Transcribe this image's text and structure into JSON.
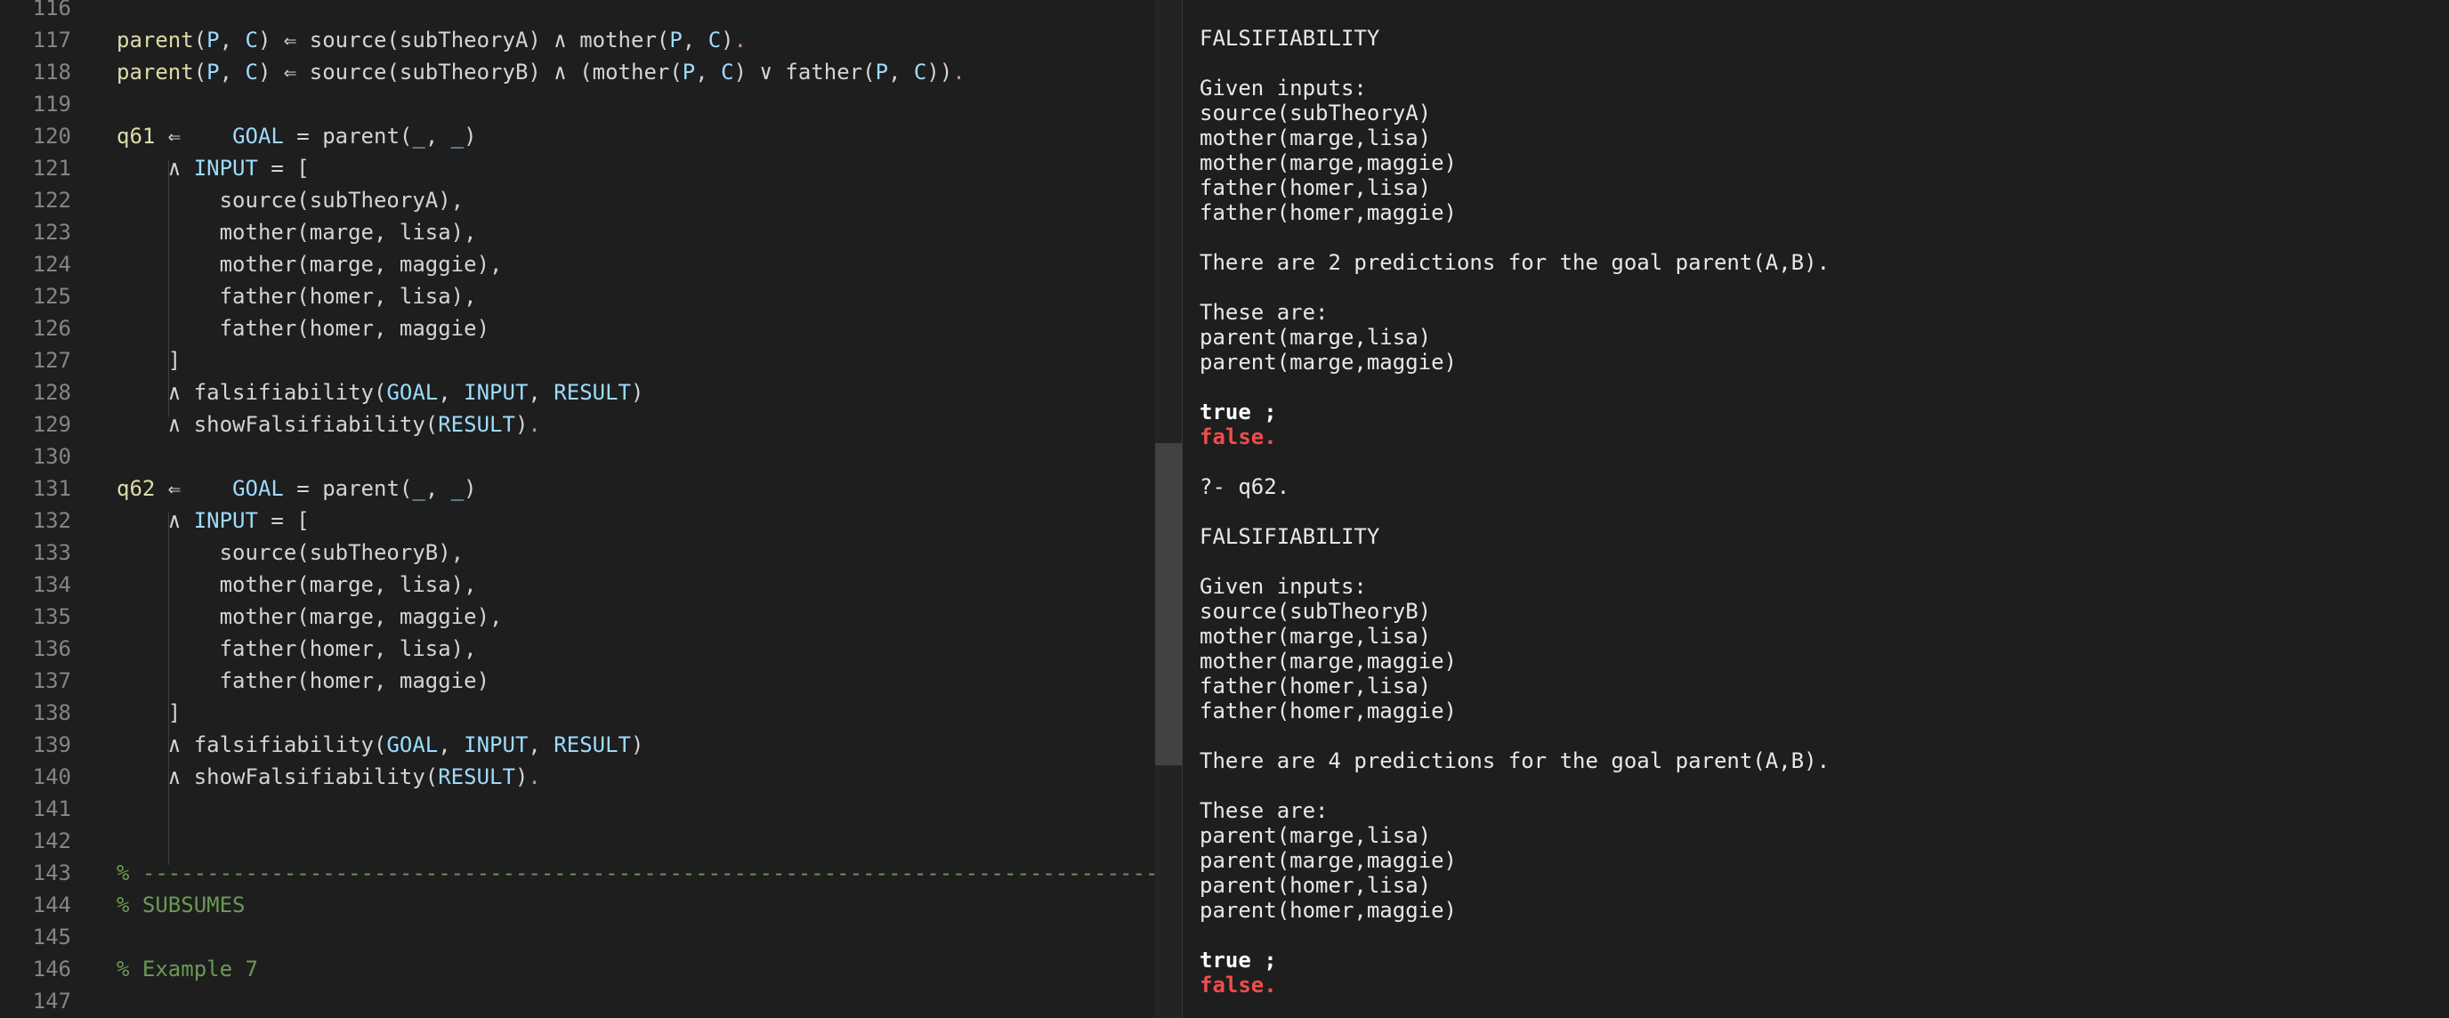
{
  "colors": {
    "background": "#1e1e1e",
    "function": "#dcdcaa",
    "variable": "#9cdcfe",
    "plain": "#d4d4d4",
    "comment": "#6a9955",
    "punctuation_end": "#c586c0",
    "line_number": "#858585",
    "error_red": "#f14c4c"
  },
  "editor": {
    "lines": [
      {
        "n": "116",
        "tokens": []
      },
      {
        "n": "117",
        "tokens": [
          [
            "fn",
            "parent"
          ],
          [
            "pl",
            "("
          ],
          [
            "var",
            "P"
          ],
          [
            "pl",
            ", "
          ],
          [
            "var",
            "C"
          ],
          [
            "pl",
            ") ⇐ source(subTheoryA) ∧ mother("
          ],
          [
            "var",
            "P"
          ],
          [
            "pl",
            ", "
          ],
          [
            "var",
            "C"
          ],
          [
            "pl",
            ")"
          ],
          [
            "pu",
            "."
          ]
        ]
      },
      {
        "n": "118",
        "tokens": [
          [
            "fn",
            "parent"
          ],
          [
            "pl",
            "("
          ],
          [
            "var",
            "P"
          ],
          [
            "pl",
            ", "
          ],
          [
            "var",
            "C"
          ],
          [
            "pl",
            ") ⇐ source(subTheoryB) ∧ (mother("
          ],
          [
            "var",
            "P"
          ],
          [
            "pl",
            ", "
          ],
          [
            "var",
            "C"
          ],
          [
            "pl",
            ") ∨ father("
          ],
          [
            "var",
            "P"
          ],
          [
            "pl",
            ", "
          ],
          [
            "var",
            "C"
          ],
          [
            "pl",
            "))"
          ],
          [
            "pu",
            "."
          ]
        ]
      },
      {
        "n": "119",
        "tokens": []
      },
      {
        "n": "120",
        "tokens": [
          [
            "fn",
            "q61"
          ],
          [
            "pl",
            " ⇐    "
          ],
          [
            "var",
            "GOAL"
          ],
          [
            "pl",
            " = parent("
          ],
          [
            "var",
            "_"
          ],
          [
            "pl",
            ", "
          ],
          [
            "var",
            "_"
          ],
          [
            "pl",
            ")"
          ]
        ]
      },
      {
        "n": "121",
        "tokens": [
          [
            "pl",
            "    ∧ "
          ],
          [
            "var",
            "INPUT"
          ],
          [
            "pl",
            " = ["
          ]
        ]
      },
      {
        "n": "122",
        "tokens": [
          [
            "pl",
            "        source(subTheoryA),"
          ]
        ]
      },
      {
        "n": "123",
        "tokens": [
          [
            "pl",
            "        mother(marge, lisa),"
          ]
        ]
      },
      {
        "n": "124",
        "tokens": [
          [
            "pl",
            "        mother(marge, maggie),"
          ]
        ]
      },
      {
        "n": "125",
        "tokens": [
          [
            "pl",
            "        father(homer, lisa),"
          ]
        ]
      },
      {
        "n": "126",
        "tokens": [
          [
            "pl",
            "        father(homer, maggie)"
          ]
        ]
      },
      {
        "n": "127",
        "tokens": [
          [
            "pl",
            "    ]"
          ]
        ]
      },
      {
        "n": "128",
        "tokens": [
          [
            "pl",
            "    ∧ falsifiability("
          ],
          [
            "var",
            "GOAL"
          ],
          [
            "pl",
            ", "
          ],
          [
            "var",
            "INPUT"
          ],
          [
            "pl",
            ", "
          ],
          [
            "var",
            "RESULT"
          ],
          [
            "pl",
            ")"
          ]
        ]
      },
      {
        "n": "129",
        "tokens": [
          [
            "pl",
            "    ∧ showFalsifiability("
          ],
          [
            "var",
            "RESULT"
          ],
          [
            "pl",
            ")"
          ],
          [
            "pu",
            "."
          ]
        ]
      },
      {
        "n": "130",
        "tokens": []
      },
      {
        "n": "131",
        "tokens": [
          [
            "fn",
            "q62"
          ],
          [
            "pl",
            " ⇐    "
          ],
          [
            "var",
            "GOAL"
          ],
          [
            "pl",
            " = parent("
          ],
          [
            "var",
            "_"
          ],
          [
            "pl",
            ", "
          ],
          [
            "var",
            "_"
          ],
          [
            "pl",
            ")"
          ]
        ]
      },
      {
        "n": "132",
        "tokens": [
          [
            "pl",
            "    ∧ "
          ],
          [
            "var",
            "INPUT"
          ],
          [
            "pl",
            " = ["
          ]
        ]
      },
      {
        "n": "133",
        "tokens": [
          [
            "pl",
            "        source(subTheoryB),"
          ]
        ]
      },
      {
        "n": "134",
        "tokens": [
          [
            "pl",
            "        mother(marge, lisa),"
          ]
        ]
      },
      {
        "n": "135",
        "tokens": [
          [
            "pl",
            "        mother(marge, maggie),"
          ]
        ]
      },
      {
        "n": "136",
        "tokens": [
          [
            "pl",
            "        father(homer, lisa),"
          ]
        ]
      },
      {
        "n": "137",
        "tokens": [
          [
            "pl",
            "        father(homer, maggie)"
          ]
        ]
      },
      {
        "n": "138",
        "tokens": [
          [
            "pl",
            "    ]"
          ]
        ]
      },
      {
        "n": "139",
        "tokens": [
          [
            "pl",
            "    ∧ falsifiability("
          ],
          [
            "var",
            "GOAL"
          ],
          [
            "pl",
            ", "
          ],
          [
            "var",
            "INPUT"
          ],
          [
            "pl",
            ", "
          ],
          [
            "var",
            "RESULT"
          ],
          [
            "pl",
            ")"
          ]
        ]
      },
      {
        "n": "140",
        "tokens": [
          [
            "pl",
            "    ∧ showFalsifiability("
          ],
          [
            "var",
            "RESULT"
          ],
          [
            "pl",
            ")"
          ],
          [
            "pu",
            "."
          ]
        ]
      },
      {
        "n": "141",
        "tokens": []
      },
      {
        "n": "142",
        "tokens": []
      },
      {
        "n": "143",
        "tokens": [
          [
            "cm",
            "% --------------------------------------------------------------------------------"
          ]
        ]
      },
      {
        "n": "144",
        "tokens": [
          [
            "cm",
            "% SUBSUMES"
          ]
        ]
      },
      {
        "n": "145",
        "tokens": []
      },
      {
        "n": "146",
        "tokens": [
          [
            "cm",
            "% Example 7"
          ]
        ]
      },
      {
        "n": "147",
        "tokens": []
      }
    ]
  },
  "terminal": {
    "lines": [
      {
        "text": "FALSIFIABILITY",
        "style": "normal"
      },
      {
        "text": "",
        "style": "normal"
      },
      {
        "text": "Given inputs:",
        "style": "normal"
      },
      {
        "text": "source(subTheoryA)",
        "style": "normal"
      },
      {
        "text": "mother(marge,lisa)",
        "style": "normal"
      },
      {
        "text": "mother(marge,maggie)",
        "style": "normal"
      },
      {
        "text": "father(homer,lisa)",
        "style": "normal"
      },
      {
        "text": "father(homer,maggie)",
        "style": "normal"
      },
      {
        "text": "",
        "style": "normal"
      },
      {
        "text": "There are 2 predictions for the goal parent(A,B).",
        "style": "normal"
      },
      {
        "text": "",
        "style": "normal"
      },
      {
        "text": "These are:",
        "style": "normal"
      },
      {
        "text": "parent(marge,lisa)",
        "style": "normal"
      },
      {
        "text": "parent(marge,maggie)",
        "style": "normal"
      },
      {
        "text": "",
        "style": "normal"
      },
      {
        "text": "true ;",
        "style": "bold"
      },
      {
        "text": "false.",
        "style": "red"
      },
      {
        "text": "",
        "style": "normal"
      },
      {
        "text": "?- q62.",
        "style": "normal"
      },
      {
        "text": "",
        "style": "normal"
      },
      {
        "text": "FALSIFIABILITY",
        "style": "normal"
      },
      {
        "text": "",
        "style": "normal"
      },
      {
        "text": "Given inputs:",
        "style": "normal"
      },
      {
        "text": "source(subTheoryB)",
        "style": "normal"
      },
      {
        "text": "mother(marge,lisa)",
        "style": "normal"
      },
      {
        "text": "mother(marge,maggie)",
        "style": "normal"
      },
      {
        "text": "father(homer,lisa)",
        "style": "normal"
      },
      {
        "text": "father(homer,maggie)",
        "style": "normal"
      },
      {
        "text": "",
        "style": "normal"
      },
      {
        "text": "There are 4 predictions for the goal parent(A,B).",
        "style": "normal"
      },
      {
        "text": "",
        "style": "normal"
      },
      {
        "text": "These are:",
        "style": "normal"
      },
      {
        "text": "parent(marge,lisa)",
        "style": "normal"
      },
      {
        "text": "parent(marge,maggie)",
        "style": "normal"
      },
      {
        "text": "parent(homer,lisa)",
        "style": "normal"
      },
      {
        "text": "parent(homer,maggie)",
        "style": "normal"
      },
      {
        "text": "",
        "style": "normal"
      },
      {
        "text": "true ;",
        "style": "bold"
      },
      {
        "text": "false.",
        "style": "red"
      }
    ]
  }
}
